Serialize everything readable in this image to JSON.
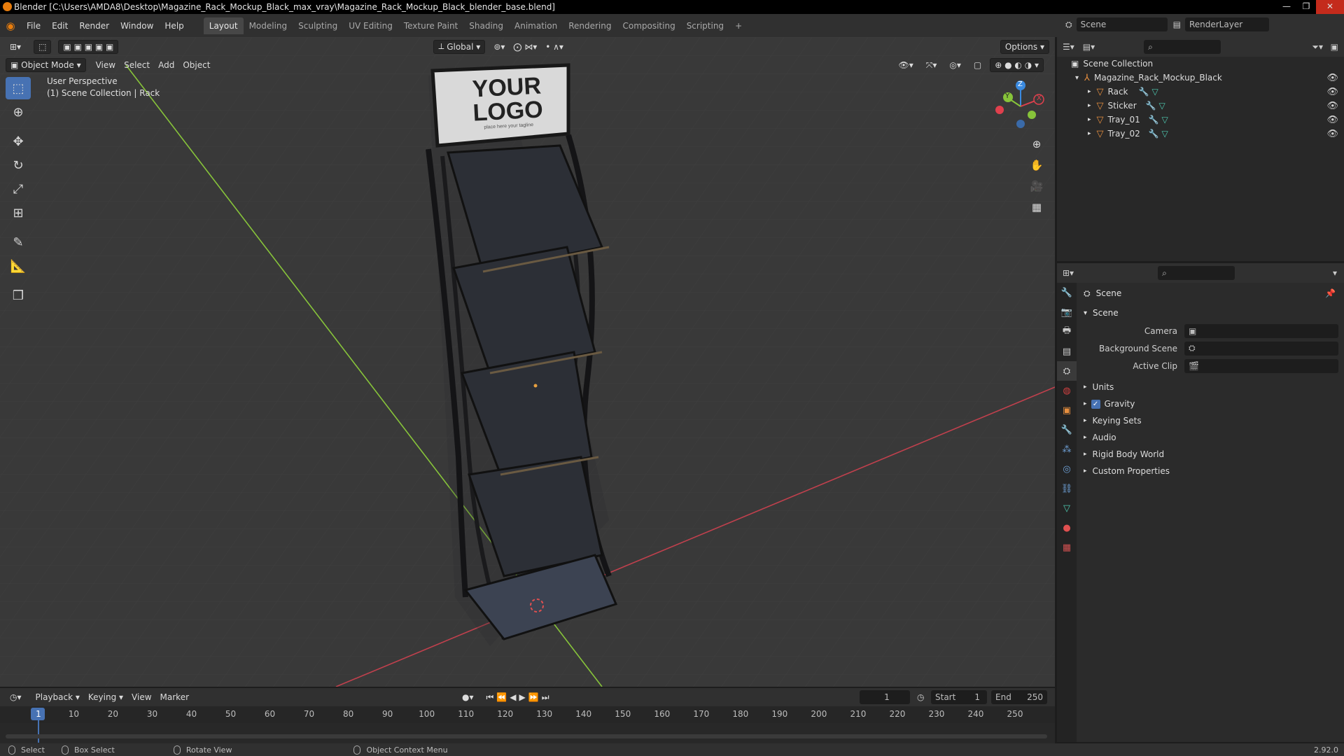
{
  "window": {
    "title": "Blender [C:\\Users\\AMDA8\\Desktop\\Magazine_Rack_Mockup_Black_max_vray\\Magazine_Rack_Mockup_Black_blender_base.blend]"
  },
  "menu": [
    "File",
    "Edit",
    "Render",
    "Window",
    "Help"
  ],
  "workspaces": [
    "Layout",
    "Modeling",
    "Sculpting",
    "UV Editing",
    "Texture Paint",
    "Shading",
    "Animation",
    "Rendering",
    "Compositing",
    "Scripting"
  ],
  "active_workspace": "Layout",
  "scene_field": "Scene",
  "renderlayer_field": "RenderLayer",
  "viewport": {
    "transform_orientation": "Global",
    "options_label": "Options",
    "mode": "Object Mode",
    "header_menus": [
      "View",
      "Select",
      "Add",
      "Object"
    ],
    "overlay_line1": "User Perspective",
    "overlay_line2": "(1) Scene Collection | Rack",
    "logo_text_1": "YOUR",
    "logo_text_2": "LOGO",
    "logo_tagline": "place here your tagline",
    "gizmo": {
      "x": "X",
      "y": "Y",
      "z": "Z"
    }
  },
  "outliner": {
    "root": "Scene Collection",
    "collection": "Magazine_Rack_Mockup_Black",
    "objects": [
      "Rack",
      "Sticker",
      "Tray_01",
      "Tray_02"
    ]
  },
  "properties": {
    "context": "Scene",
    "panel": "Scene",
    "camera_label": "Camera",
    "background_scene_label": "Background Scene",
    "active_clip_label": "Active Clip",
    "subpanels": [
      "Units",
      "Gravity",
      "Keying Sets",
      "Audio",
      "Rigid Body World",
      "Custom Properties"
    ],
    "gravity_checked": true
  },
  "timeline": {
    "menus": [
      "Playback",
      "Keying",
      "View",
      "Marker"
    ],
    "current_frame": "1",
    "start_label": "Start",
    "start_value": "1",
    "end_label": "End",
    "end_value": "250",
    "ticks": [
      "1",
      "10",
      "20",
      "30",
      "40",
      "50",
      "60",
      "70",
      "80",
      "90",
      "100",
      "110",
      "120",
      "130",
      "140",
      "150",
      "160",
      "170",
      "180",
      "190",
      "200",
      "210",
      "220",
      "230",
      "240",
      "250"
    ]
  },
  "status": {
    "select": "Select",
    "box_select": "Box Select",
    "rotate_view": "Rotate View",
    "context_menu": "Object Context Menu",
    "version": "2.92.0"
  },
  "colors": {
    "accent": "#4772b3",
    "axis_x": "#e0404d",
    "axis_y": "#87c43a",
    "axis_z": "#3a8ae0",
    "object_orange": "#e88f3f"
  }
}
